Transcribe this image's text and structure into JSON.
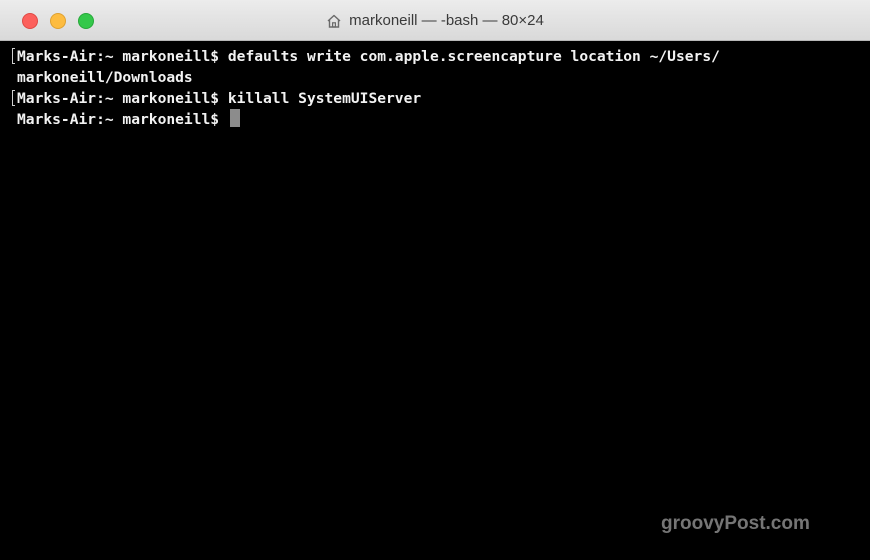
{
  "window": {
    "title": "markoneill — -bash — 80×24",
    "title_icon": "home-icon",
    "traffic_lights": {
      "close_color": "#fc605c",
      "minimize_color": "#fdbc40",
      "zoom_color": "#34c84a"
    }
  },
  "terminal": {
    "background": "#000000",
    "foreground": "#f2f2f2",
    "lines": [
      "Marks-Air:~ markoneill$ defaults write com.apple.screencapture location ~/Users/",
      "markoneill/Downloads",
      "Marks-Air:~ markoneill$ killall SystemUIServer",
      "Marks-Air:~ markoneill$ "
    ]
  },
  "watermark": "groovyPost.com"
}
